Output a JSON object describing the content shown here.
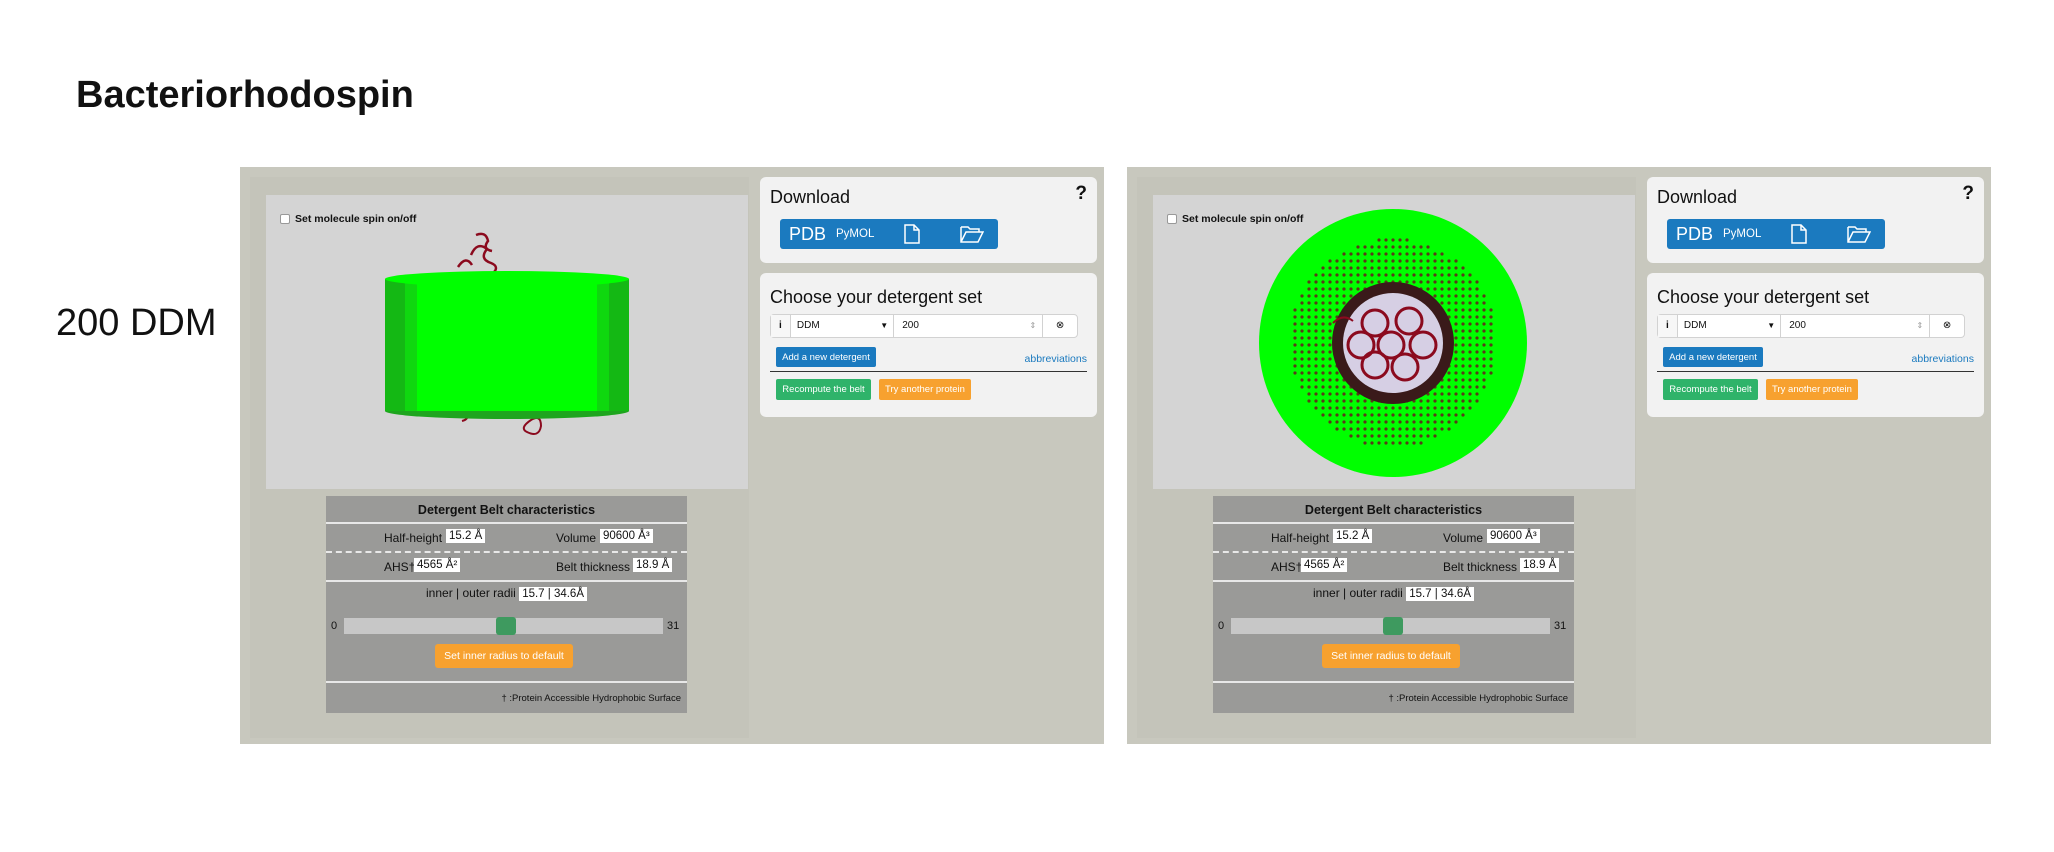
{
  "page": {
    "title": "Bacteriorhodospin",
    "row_label": "200 DDM"
  },
  "panels": [
    {
      "view": "side",
      "spin_label": "Set molecule spin on/off",
      "belt": {
        "header": "Detergent Belt characteristics",
        "half_height_label": "Half-height",
        "half_height_value": "15.2 Å",
        "volume_label": "Volume",
        "volume_value": "90600 Å³",
        "ahs_label": "AHS†",
        "ahs_value": "4565 Å²",
        "thickness_label": "Belt thickness",
        "thickness_value": "18.9 Å",
        "radii_label": "inner | outer radii",
        "radii_value": "15.7 | 34.6Å",
        "slider_min": "0",
        "slider_max": "31",
        "slider_value": 15.7,
        "default_button": "Set inner radius to default",
        "footnote": "† :Protein Accessible Hydrophobic Surface"
      },
      "download": {
        "title": "Download",
        "help": "?",
        "pdb": "PDB",
        "pymol": "PyMOL"
      },
      "detergent": {
        "title": "Choose your detergent set",
        "info": "i",
        "selected": "DDM",
        "quantity": "200",
        "add_button": "Add a new detergent",
        "abbreviations": "abbreviations",
        "recompute_button": "Recompute the belt",
        "another_button": "Try another protein"
      }
    },
    {
      "view": "top",
      "spin_label": "Set molecule spin on/off",
      "belt": {
        "header": "Detergent Belt characteristics",
        "half_height_label": "Half-height",
        "half_height_value": "15.2 Å",
        "volume_label": "Volume",
        "volume_value": "90600 Å³",
        "ahs_label": "AHS†",
        "ahs_value": "4565 Å²",
        "thickness_label": "Belt thickness",
        "thickness_value": "18.9 Å",
        "radii_label": "inner | outer radii",
        "radii_value": "15.7 | 34.6Å",
        "slider_min": "0",
        "slider_max": "31",
        "slider_value": 15.7,
        "default_button": "Set inner radius to default",
        "footnote": "† :Protein Accessible Hydrophobic Surface"
      },
      "download": {
        "title": "Download",
        "help": "?",
        "pdb": "PDB",
        "pymol": "PyMOL"
      },
      "detergent": {
        "title": "Choose your detergent set",
        "info": "i",
        "selected": "DDM",
        "quantity": "200",
        "add_button": "Add a new detergent",
        "abbreviations": "abbreviations",
        "recompute_button": "Recompute the belt",
        "another_button": "Try another protein"
      }
    }
  ],
  "colors": {
    "belt_green": "#00ff00",
    "protein_red": "#8b0a1e",
    "accent_blue": "#1b7abf",
    "orange": "#f7a12f",
    "green_button": "#2fb36a"
  }
}
